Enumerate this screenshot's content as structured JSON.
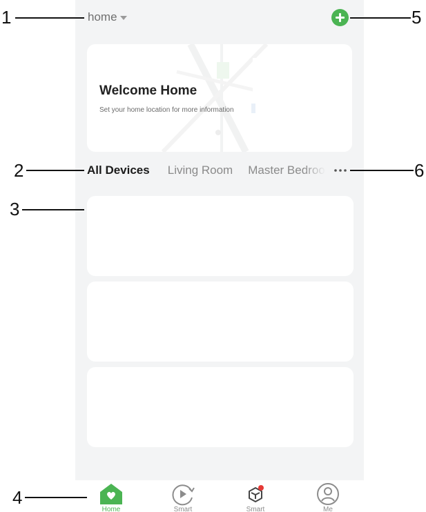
{
  "header": {
    "home_name": "home",
    "add_icon": "plus-circle-icon"
  },
  "welcome": {
    "title": "Welcome Home",
    "subtitle": "Set your home location for more information"
  },
  "tabs": [
    {
      "label": "All Devices",
      "active": true
    },
    {
      "label": "Living Room",
      "active": false
    },
    {
      "label": "Master Bedroom",
      "active": false
    }
  ],
  "more_icon": "more-dots-icon",
  "device_cards": [
    {},
    {},
    {}
  ],
  "bottom_nav": [
    {
      "label": "Home",
      "icon": "home-icon",
      "active": true
    },
    {
      "label": "Smart",
      "icon": "smart-scene-icon",
      "active": false
    },
    {
      "label": "Smart",
      "icon": "smart-cube-icon",
      "active": false,
      "badge": true
    },
    {
      "label": "Me",
      "icon": "profile-icon",
      "active": false
    }
  ],
  "annotations": [
    "1",
    "2",
    "3",
    "4",
    "5",
    "6"
  ],
  "colors": {
    "accent": "#4bb453",
    "background": "#f3f4f5",
    "badge": "#e53935"
  }
}
